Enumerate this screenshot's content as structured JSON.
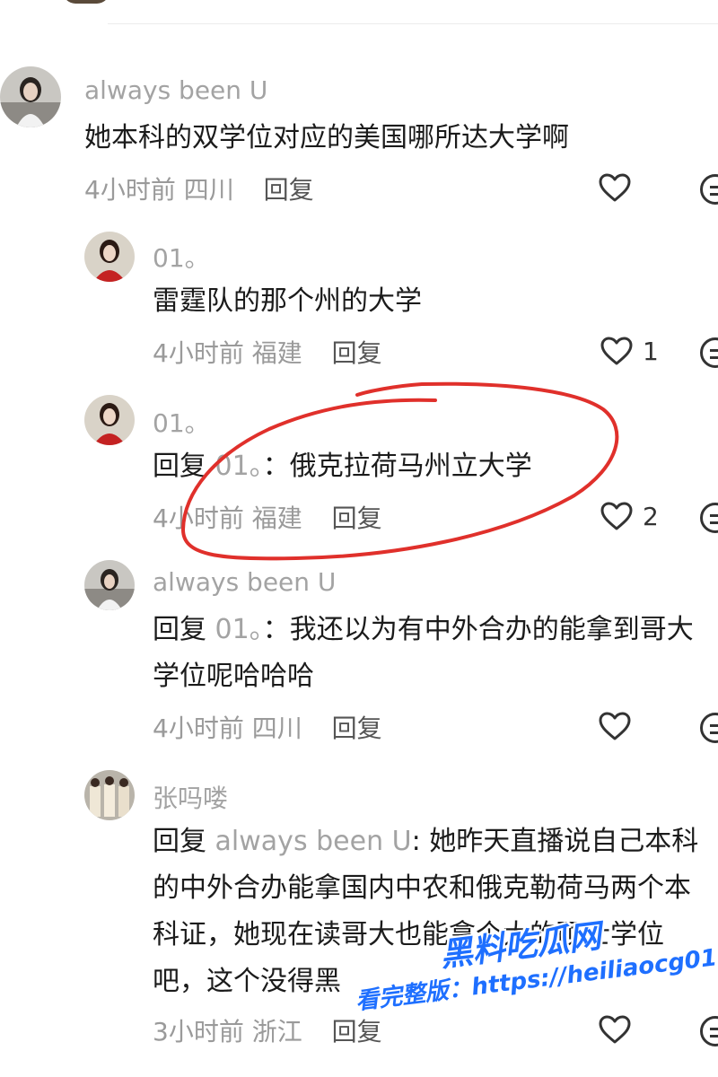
{
  "comments": [
    {
      "username": "always been U",
      "text": "她本科的双学位对应的美国哪所达大学啊",
      "time": "4小时前",
      "location": "四川",
      "reply_label": "回复",
      "likes": ""
    },
    {
      "username": "01。",
      "text": "雷霆队的那个州的大学",
      "time": "4小时前",
      "location": "福建",
      "reply_label": "回复",
      "likes": "1"
    },
    {
      "username": "01。",
      "reply_prefix": "回复",
      "mention": "01。",
      "text": "：俄克拉荷马州立大学",
      "time": "4小时前",
      "location": "福建",
      "reply_label": "回复",
      "likes": "2"
    },
    {
      "username": "always been U",
      "reply_prefix": "回复",
      "mention": "01。",
      "text_line1": "：我还以为有中外合办的能拿到哥大",
      "text_line2": "学位呢哈哈哈",
      "time": "4小时前",
      "location": "四川",
      "reply_label": "回复",
      "likes": ""
    },
    {
      "username": "张吗喽",
      "reply_prefix": "回复",
      "mention": "always been U",
      "text_line1": ": 她昨天直播说自己本科",
      "text_line2": "的中外合办能拿国内中农和俄克勒荷马两个本",
      "text_line3": "科证，她现在读哥大也能拿个大的硕士学位",
      "text_line4": "吧，这个没得黑",
      "time": "3小时前",
      "location": "浙江",
      "reply_label": "回复",
      "likes": ""
    }
  ],
  "watermark": {
    "brand": "黑料吃瓜网",
    "url_prefix": "看完整版：",
    "url": "https://heiliaocg01.com"
  },
  "colors": {
    "annotation_circle": "#e0302b",
    "watermark": "#1e6fff",
    "username": "#a3a3a3"
  }
}
